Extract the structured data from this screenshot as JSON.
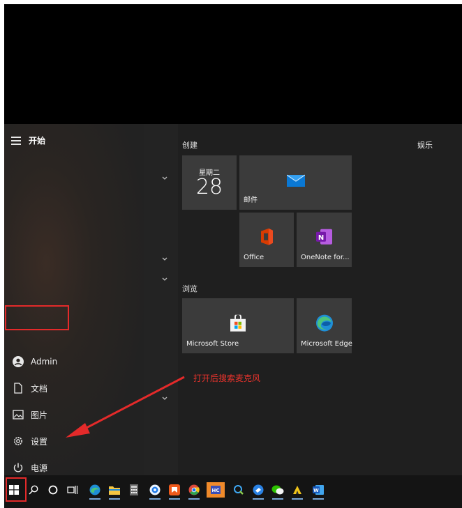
{
  "start_menu": {
    "title": "开始",
    "rail": {
      "user": "Admin",
      "documents": "文档",
      "pictures": "图片",
      "settings": "设置",
      "power": "电源"
    },
    "sections": {
      "create": "创建",
      "entertainment": "娱乐",
      "browse": "浏览"
    },
    "tiles": {
      "calendar_day": "星期二",
      "calendar_date": "28",
      "mail": "邮件",
      "office": "Office",
      "onenote": "OneNote for...",
      "store": "Microsoft Store",
      "edge": "Microsoft Edge"
    }
  },
  "annotation": {
    "text": "打开后搜索麦克风",
    "color": "#e8332c"
  },
  "taskbar": {
    "icons": [
      "windows-start-icon",
      "search-icon",
      "cortana-icon",
      "task-view-icon",
      "edge-icon",
      "file-explorer-icon",
      "calculator-icon",
      "qq-browser-icon",
      "app-orange-icon",
      "chrome-icon",
      "hc-app-icon",
      "screenshot-tool-icon",
      "feishu-icon",
      "wechat-icon",
      "app-yellow-icon",
      "word-icon"
    ]
  },
  "colors": {
    "tile_bg": "#3b3b3b",
    "menu_bg": "#1f1f1f",
    "highlight": "#e42a2a"
  }
}
